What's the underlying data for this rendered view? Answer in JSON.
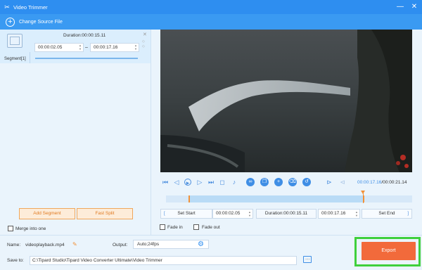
{
  "window": {
    "title": "Video Trimmer",
    "minimize": "—",
    "close": "✕"
  },
  "toolbar": {
    "change_source": "Change Source File"
  },
  "segment": {
    "duration": "Duration:00:00:15.11",
    "start": "00:00:02.05",
    "end": "00:00:17.16",
    "dash": "–",
    "label": "Segment[1]"
  },
  "left_actions": {
    "add_segment": "Add Segment",
    "fast_split": "Fast Split",
    "merge": "Merge into one"
  },
  "player": {
    "current_time": "00:00:17.16",
    "total_time": "00:00:21.14",
    "separator": "/",
    "selection_start_fraction": 0.1,
    "selection_end_fraction": 0.81,
    "playhead_fraction": 0.81
  },
  "trim": {
    "set_start": "Set Start",
    "start_value": "00:00:02.05",
    "duration": "Duration:00:00:15.11",
    "end_value": "00:00:17.16",
    "set_end": "Set End",
    "fade_in": "Fade in",
    "fade_out": "Fade out"
  },
  "output": {
    "name_label": "Name:",
    "name_value": "videoplayback.mp4",
    "output_label": "Output:",
    "output_value": "Auto;24fps",
    "save_label": "Save to:",
    "save_path": "C:\\Tipard Studio\\Tipard Video Converter Ultimate\\Video Trimmer",
    "more": "···",
    "export": "Export"
  },
  "colors": {
    "titlebar": "#2e8ef0",
    "accent": "#3f8ee5",
    "export": "#f26a3b",
    "highlight": "#3fd03c",
    "handle": "#f39137"
  }
}
